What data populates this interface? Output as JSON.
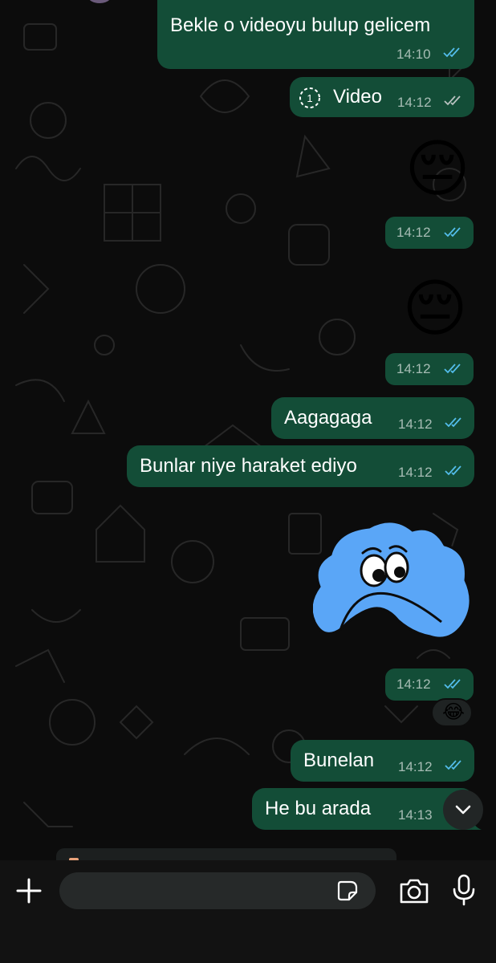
{
  "messages": [
    {
      "text": "Bekle o videoyu bulup gelicem",
      "time": "14:10",
      "status": "read"
    },
    {
      "text": "Video",
      "time": "14:12",
      "status": "delivered",
      "type": "video"
    },
    {
      "emoji": "😔",
      "time": "14:12",
      "status": "read",
      "type": "emoji"
    },
    {
      "emoji": "😔",
      "time": "14:12",
      "status": "read",
      "type": "emoji"
    },
    {
      "text": "Aagagaga",
      "time": "14:12",
      "status": "read"
    },
    {
      "text": "Bunlar niye haraket ediyo",
      "time": "14:12",
      "status": "read"
    },
    {
      "time": "14:12",
      "status": "read",
      "type": "sticker",
      "reaction": "😂"
    },
    {
      "text": "Bunelan",
      "time": "14:12",
      "status": "read"
    },
    {
      "text": "He bu arada",
      "time": "14:13",
      "status": "read"
    }
  ],
  "composer": {
    "placeholder": ""
  },
  "icons": {
    "attach": "plus-icon",
    "sticker": "sticker-icon",
    "camera": "camera-icon",
    "mic": "microphone-icon",
    "scroll": "chevron-down-icon"
  },
  "colors": {
    "outgoing_bubble": "#134d37",
    "read_tick": "#53bdeb",
    "background": "#0c0c0c"
  }
}
